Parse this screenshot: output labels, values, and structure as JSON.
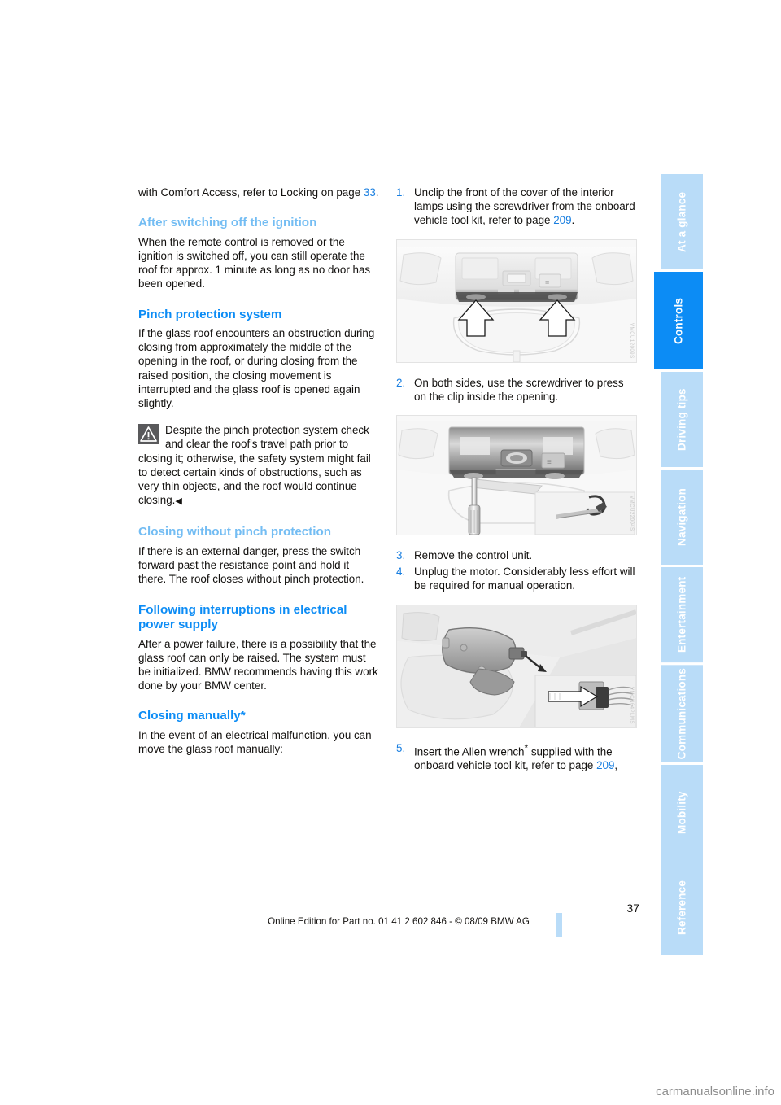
{
  "document": {
    "page_number": "37",
    "imprint": "Online Edition for Part no. 01 41 2 602 846 - © 08/09 BMW AG",
    "watermark": "carmanualsonline.info"
  },
  "tabs": [
    {
      "label": "At a glance",
      "active": false
    },
    {
      "label": "Controls",
      "active": true
    },
    {
      "label": "Driving tips",
      "active": false
    },
    {
      "label": "Navigation",
      "active": false
    },
    {
      "label": "Entertainment",
      "active": false
    },
    {
      "label": "Communications",
      "active": false
    },
    {
      "label": "Mobility",
      "active": false
    },
    {
      "label": "Reference",
      "active": false
    }
  ],
  "left_column": {
    "intro": {
      "text_before": "with Comfort Access, refer to Locking on page ",
      "page_ref": "33",
      "text_after": "."
    },
    "section_ignition": {
      "heading": "After switching off the ignition",
      "body": "When the remote control is removed or the ignition is switched off, you can still operate the roof for approx. 1 minute as long as no door has been opened."
    },
    "section_pinch": {
      "heading": "Pinch protection system",
      "body": "If the glass roof encounters an obstruction during closing from approximately the middle of the opening in the roof, or during closing from the raised position, the closing movement is interrupted and the glass roof is opened again slightly.",
      "warning": "Despite the pinch protection system check and clear the roof's travel path prior to closing it; otherwise, the safety system might fail to detect certain kinds of obstructions, such as very thin objects, and the roof would continue closing.",
      "warning_endmark": "◀",
      "warning_icon": "warning-triangle-icon"
    },
    "section_without_pinch": {
      "heading": "Closing without pinch protection",
      "body": "If there is an external danger, press the switch forward past the resistance point and hold it there. The roof closes without pinch protection."
    },
    "section_power": {
      "heading": "Following interruptions in electrical power supply",
      "body": "After a power failure, there is a possibility that the glass roof can only be raised. The system must be initialized. BMW recommends having this work done by your BMW center."
    },
    "section_manual": {
      "heading": "Closing manually*",
      "body": "In the event of an electrical malfunction, you can move the glass roof manually:"
    }
  },
  "right_column": {
    "step1": {
      "num": "1.",
      "text_before": "Unclip the front of the cover of the interior lamps using the screwdriver from the onboard vehicle tool kit, refer to page ",
      "page_ref": "209",
      "text_after": "."
    },
    "figure1_code": "VMCU12009S",
    "step2": {
      "num": "2.",
      "text": "On both sides, use the screwdriver to press on the clip inside the opening."
    },
    "figure2_code": "VMCU22004S",
    "step3": {
      "num": "3.",
      "text": "Remove the control unit."
    },
    "step4": {
      "num": "4.",
      "text": "Unplug the motor. Considerably less effort will be required for manual operation."
    },
    "figure3_code": "VMCN64PLMS",
    "step5": {
      "num": "5.",
      "text_before": "Insert the Allen wrench",
      "asterisk": "*",
      "text_mid": " supplied with the onboard vehicle tool kit, refer to page ",
      "page_ref": "209",
      "text_after": ","
    }
  },
  "colors": {
    "heading_light": "#74bdf3",
    "heading_strong": "#0c8cf5",
    "page_ref": "#1a7fe0",
    "tab_active": "#0c8cf5",
    "tab_inactive": "#b9dcf8"
  }
}
